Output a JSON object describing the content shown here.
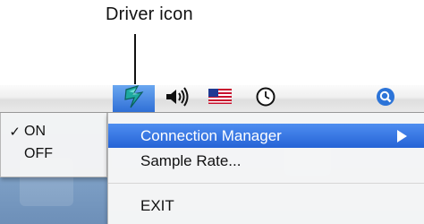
{
  "callout": {
    "label": "Driver icon"
  },
  "menubar": {
    "icons": [
      "driver-icon",
      "volume-icon",
      "us-flag-icon",
      "clock-icon",
      "spotlight-icon"
    ]
  },
  "submenu": {
    "items": [
      {
        "label": "ON",
        "checked": true,
        "check_glyph": "✓"
      },
      {
        "label": "OFF",
        "checked": false
      }
    ]
  },
  "menu": {
    "items": [
      {
        "label": "Connection Manager",
        "highlighted": true,
        "has_submenu": true
      },
      {
        "label": "Sample Rate..."
      },
      {
        "label": "EXIT"
      }
    ]
  },
  "colors": {
    "highlight": "#2f6fd6",
    "desktop": "#7d9fc5"
  }
}
